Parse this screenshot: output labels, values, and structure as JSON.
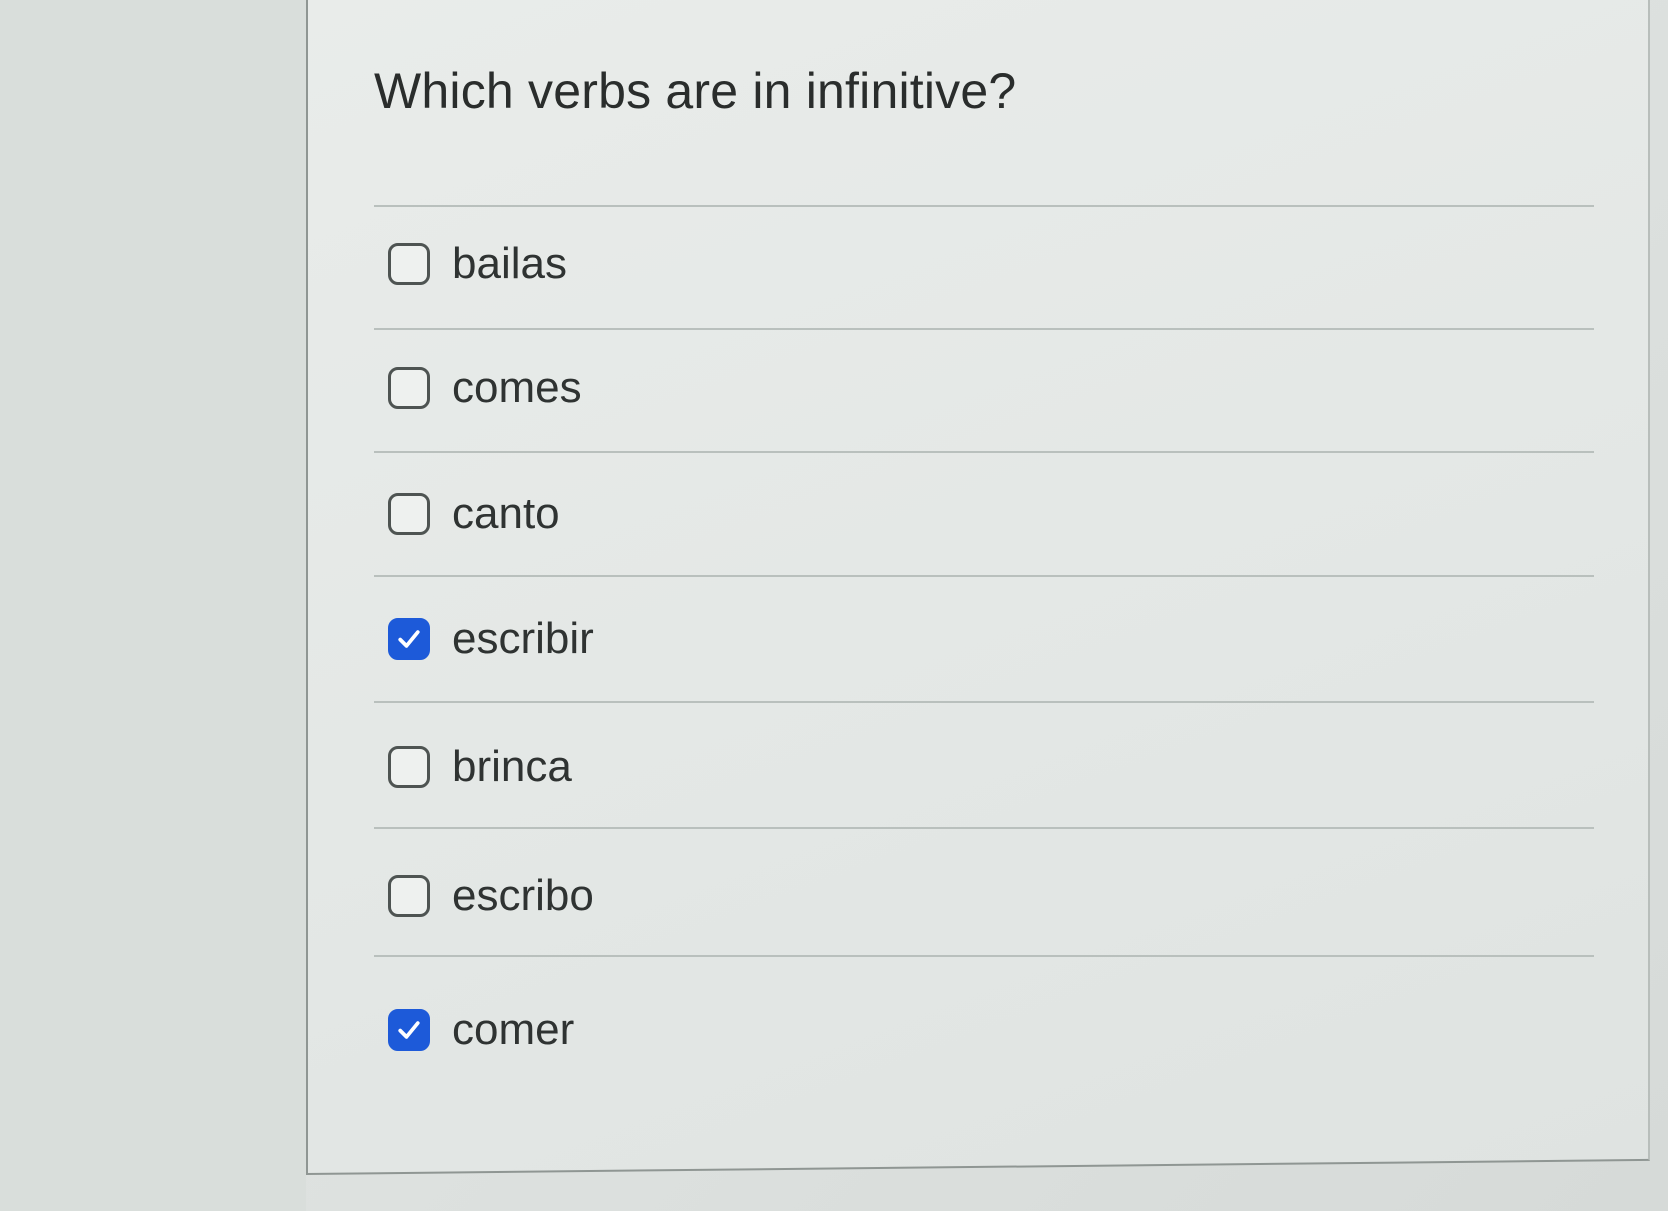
{
  "question": {
    "title": "Which verbs are in infinitive?"
  },
  "options": [
    {
      "label": "bailas",
      "checked": false
    },
    {
      "label": "comes",
      "checked": false
    },
    {
      "label": "canto",
      "checked": false
    },
    {
      "label": "escribir",
      "checked": true
    },
    {
      "label": "brinca",
      "checked": false
    },
    {
      "label": "escribo",
      "checked": false
    },
    {
      "label": "comer",
      "checked": true
    }
  ],
  "colors": {
    "checked_accent": "#1d5ad9",
    "checkmark": "#ffffff",
    "text": "#2f3332"
  },
  "icons": {
    "checked": "checkmark-icon",
    "unchecked": "empty-checkbox"
  }
}
